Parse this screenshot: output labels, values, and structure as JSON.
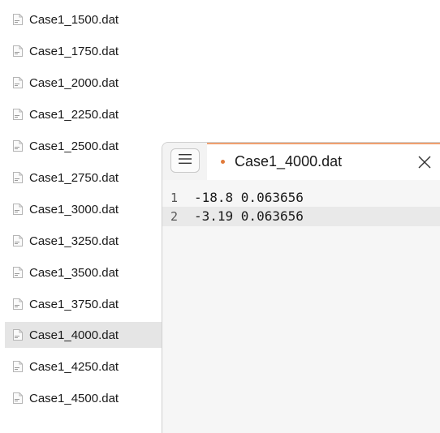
{
  "file_list": {
    "items": [
      {
        "name": "Case1_1500.dat",
        "selected": false,
        "icon": "dat-file-icon"
      },
      {
        "name": "Case1_1750.dat",
        "selected": false,
        "icon": "dat-file-icon"
      },
      {
        "name": "Case1_2000.dat",
        "selected": false,
        "icon": "dat-file-icon"
      },
      {
        "name": "Case1_2250.dat",
        "selected": false,
        "icon": "dat-file-icon"
      },
      {
        "name": "Case1_2500.dat",
        "selected": false,
        "icon": "dat-file-icon"
      },
      {
        "name": "Case1_2750.dat",
        "selected": false,
        "icon": "dat-file-icon"
      },
      {
        "name": "Case1_3000.dat",
        "selected": false,
        "icon": "dat-file-icon"
      },
      {
        "name": "Case1_3250.dat",
        "selected": false,
        "icon": "dat-file-icon"
      },
      {
        "name": "Case1_3500.dat",
        "selected": false,
        "icon": "dat-file-icon"
      },
      {
        "name": "Case1_3750.dat",
        "selected": false,
        "icon": "dat-file-icon"
      },
      {
        "name": "Case1_4000.dat",
        "selected": true,
        "icon": "dat-file-icon"
      },
      {
        "name": "Case1_4250.dat",
        "selected": false,
        "icon": "dat-file-icon"
      },
      {
        "name": "Case1_4500.dat",
        "selected": false,
        "icon": "dat-file-icon"
      }
    ]
  },
  "editor": {
    "menu_icon": "hamburger-menu-icon",
    "tab": {
      "title": "Case1_4000.dat",
      "unsaved": true,
      "dot_color": "#e07a3a",
      "close_icon": "close-icon"
    },
    "lines": [
      {
        "number": "1",
        "text": "-18.8 0.063656",
        "current": false
      },
      {
        "number": "2",
        "text": "-3.19 0.063656",
        "current": true
      }
    ]
  },
  "colors": {
    "selection": "#e5e5e5",
    "tab_accent": "#f0a070",
    "current_line": "#e9e9e9"
  }
}
